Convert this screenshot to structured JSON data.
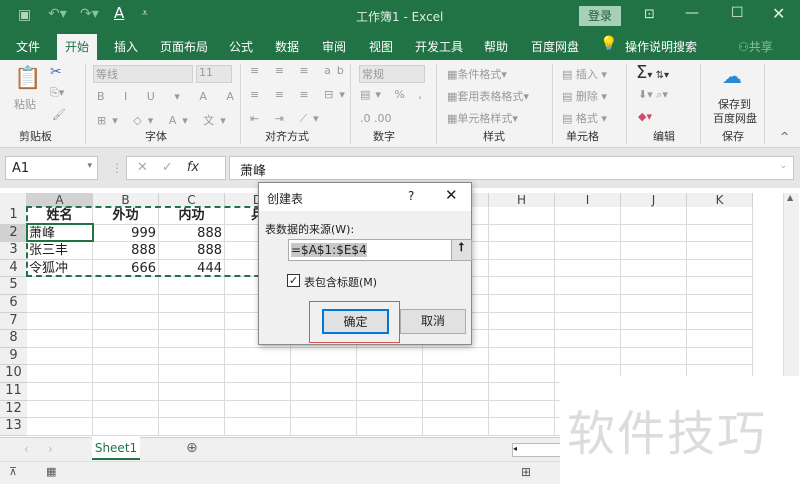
{
  "window": {
    "title": "工作簿1  -  Excel",
    "login": "登录",
    "share": "共享"
  },
  "tabs": [
    "文件",
    "开始",
    "插入",
    "页面布局",
    "公式",
    "数据",
    "审阅",
    "视图",
    "开发工具",
    "帮助",
    "百度网盘",
    "操作说明搜索"
  ],
  "active_tab": "开始",
  "ribbon": {
    "paste": "粘贴",
    "font_name": "等线",
    "font_size": "11",
    "number_format": "常规",
    "cond_format": "条件格式",
    "table_format": "套用表格格式",
    "cell_style": "单元格样式",
    "insert": "插入",
    "delete": "删除",
    "format": "格式",
    "save_to": "保存到",
    "baidu": "百度网盘",
    "groups": [
      "剪贴板",
      "字体",
      "对齐方式",
      "数字",
      "样式",
      "单元格",
      "编辑",
      "保存"
    ]
  },
  "formula_bar": {
    "name_box": "A1",
    "fx": "fx",
    "content": "萧峰"
  },
  "columns": [
    "A",
    "B",
    "C",
    "D",
    "E",
    "F",
    "G",
    "H",
    "I",
    "J",
    "K"
  ],
  "rows": [
    "1",
    "2",
    "3",
    "4",
    "5",
    "6",
    "7",
    "8",
    "9",
    "10",
    "11",
    "12",
    "13"
  ],
  "cells": [
    [
      "姓名",
      "外功",
      "内功",
      "兵"
    ],
    [
      "萧峰",
      "999",
      "888",
      ""
    ],
    [
      "张三丰",
      "888",
      "888",
      ""
    ],
    [
      "令狐冲",
      "666",
      "444",
      ""
    ]
  ],
  "dialog": {
    "title": "创建表",
    "help": "?",
    "source_label": "表数据的来源(W):",
    "range": "=$A$1:$E$4",
    "has_headers": "表包含标题(M)",
    "has_headers_checked": true,
    "ok": "确定",
    "cancel": "取消"
  },
  "sheet_tabs": [
    "Sheet1"
  ],
  "watermark": "软件技巧",
  "colors": {
    "excel_green": "#217346",
    "highlight_red": "#d9534f",
    "ok_border": "#0078d7"
  }
}
